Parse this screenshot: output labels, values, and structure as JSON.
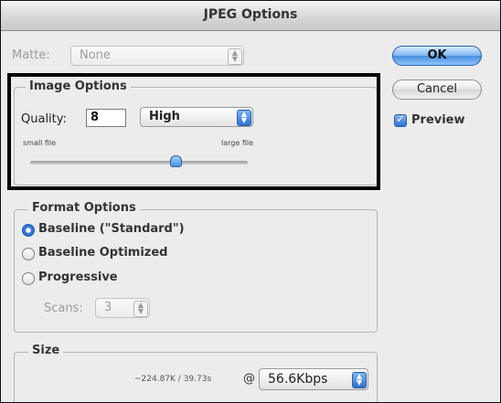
{
  "dialog": {
    "title": "JPEG Options"
  },
  "matte": {
    "label": "Matte:",
    "value": "None"
  },
  "image_options": {
    "title": "Image Options",
    "quality_label": "Quality:",
    "quality_value": "8",
    "quality_preset": "High",
    "slider_min_label": "small file",
    "slider_max_label": "large file",
    "quality_max": 12
  },
  "format_options": {
    "title": "Format Options",
    "options": [
      "Baseline (\"Standard\")",
      "Baseline Optimized",
      "Progressive"
    ],
    "selected": "Baseline (\"Standard\")",
    "scans_label": "Scans:",
    "scans_value": "3"
  },
  "size": {
    "title": "Size",
    "estimate": "~224.87K / 39.73s",
    "at": "@",
    "speed": "56.6Kbps"
  },
  "buttons": {
    "ok": "OK",
    "cancel": "Cancel"
  },
  "preview": {
    "label": "Preview",
    "checked": true
  },
  "colors": {
    "accent": "#3b80d8",
    "highlight_box": "#000000"
  }
}
